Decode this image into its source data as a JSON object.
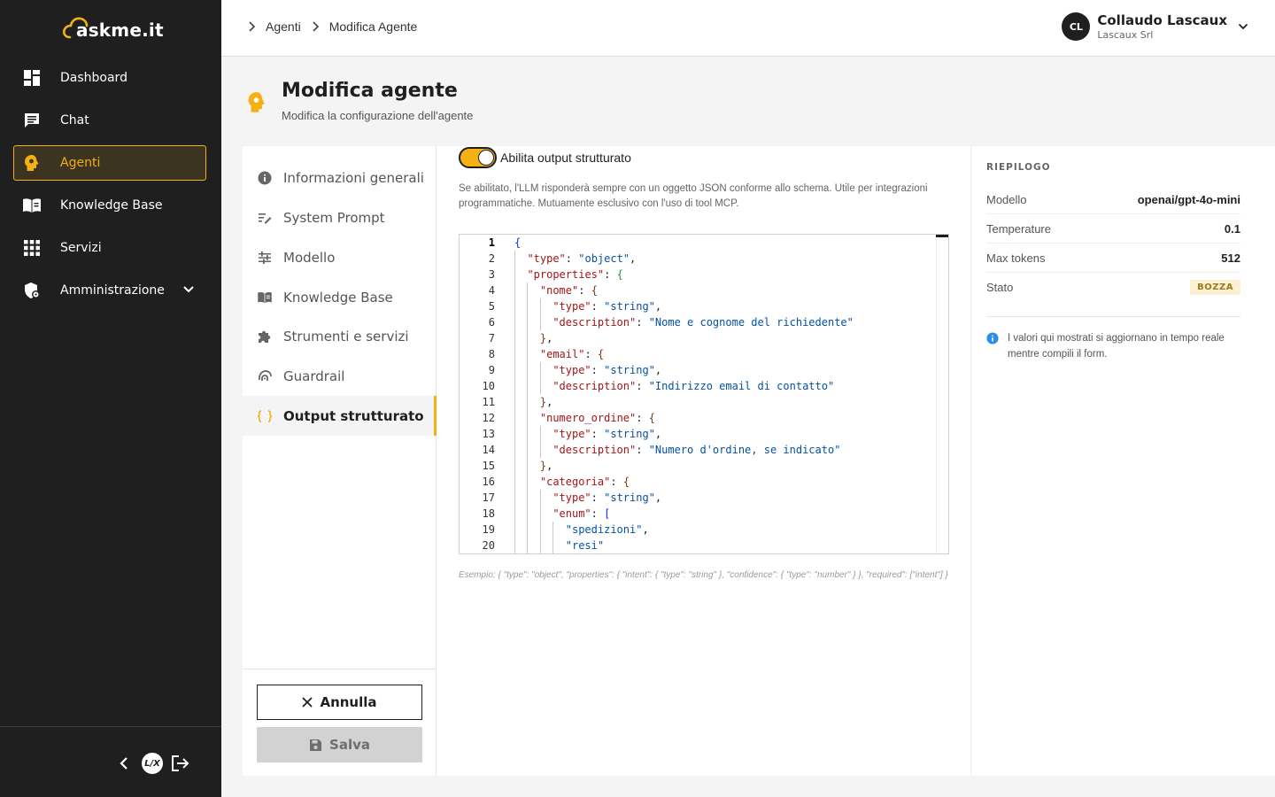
{
  "app": {
    "logo_text": "askme.it"
  },
  "sidebar": {
    "items": [
      {
        "label": "Dashboard",
        "icon": "dashboard-icon"
      },
      {
        "label": "Chat",
        "icon": "chat-icon"
      },
      {
        "label": "Agenti",
        "icon": "agent-icon"
      },
      {
        "label": "Knowledge Base",
        "icon": "book-icon"
      },
      {
        "label": "Servizi",
        "icon": "grid-icon"
      },
      {
        "label": "Amministrazione",
        "icon": "admin-shield-icon"
      }
    ],
    "footer_badge": "L/X"
  },
  "header": {
    "breadcrumb": [
      "Agenti",
      "Modifica Agente"
    ],
    "user": {
      "initials": "CL",
      "name": "Collaudo Lascaux",
      "org": "Lascaux Srl"
    }
  },
  "page": {
    "title": "Modifica agente",
    "subtitle": "Modifica la configurazione dell'agente"
  },
  "tabs": [
    {
      "label": "Informazioni generali",
      "icon": "info-icon"
    },
    {
      "label": "System Prompt",
      "icon": "prompt-edit-icon"
    },
    {
      "label": "Modello",
      "icon": "tune-icon"
    },
    {
      "label": "Knowledge Base",
      "icon": "book-icon"
    },
    {
      "label": "Strumenti e servizi",
      "icon": "puzzle-icon"
    },
    {
      "label": "Guardrail",
      "icon": "guardrail-icon"
    },
    {
      "label": "Output strutturato",
      "icon": "braces-icon"
    }
  ],
  "actions": {
    "cancel": "Annulla",
    "save": "Salva"
  },
  "structured_output": {
    "toggle_label": "Abilita output strutturato",
    "toggle_on": true,
    "help": "Se abilitato, l'LLM risponderà sempre con un oggetto JSON conforme allo schema. Utile per integrazioni programmatiche. Mutuamente esclusivo con l'uso di tool MCP.",
    "example": "Esempio: { \"type\": \"object\", \"properties\": { \"intent\": { \"type\": \"string\" }, \"confidence\": { \"type\": \"number\" } }, \"required\": [\"intent\"] }",
    "code_lines": [
      {
        "n": "1",
        "depth": 0,
        "parts": [
          [
            "b1",
            "{"
          ]
        ]
      },
      {
        "n": "2",
        "depth": 1,
        "parts": [
          [
            "k",
            "\"type\""
          ],
          [
            "p",
            ": "
          ],
          [
            "s",
            "\"object\""
          ],
          [
            "p",
            ","
          ]
        ]
      },
      {
        "n": "3",
        "depth": 1,
        "parts": [
          [
            "k",
            "\"properties\""
          ],
          [
            "p",
            ": "
          ],
          [
            "b2",
            "{"
          ]
        ]
      },
      {
        "n": "4",
        "depth": 2,
        "parts": [
          [
            "k",
            "\"nome\""
          ],
          [
            "p",
            ": "
          ],
          [
            "b3",
            "{"
          ]
        ]
      },
      {
        "n": "5",
        "depth": 3,
        "parts": [
          [
            "k",
            "\"type\""
          ],
          [
            "p",
            ": "
          ],
          [
            "s",
            "\"string\""
          ],
          [
            "p",
            ","
          ]
        ]
      },
      {
        "n": "6",
        "depth": 3,
        "parts": [
          [
            "k",
            "\"description\""
          ],
          [
            "p",
            ": "
          ],
          [
            "s",
            "\"Nome e cognome del richiedente\""
          ]
        ]
      },
      {
        "n": "7",
        "depth": 2,
        "parts": [
          [
            "b3",
            "}"
          ],
          [
            "p",
            ","
          ]
        ]
      },
      {
        "n": "8",
        "depth": 2,
        "parts": [
          [
            "k",
            "\"email\""
          ],
          [
            "p",
            ": "
          ],
          [
            "b3",
            "{"
          ]
        ]
      },
      {
        "n": "9",
        "depth": 3,
        "parts": [
          [
            "k",
            "\"type\""
          ],
          [
            "p",
            ": "
          ],
          [
            "s",
            "\"string\""
          ],
          [
            "p",
            ","
          ]
        ]
      },
      {
        "n": "10",
        "depth": 3,
        "parts": [
          [
            "k",
            "\"description\""
          ],
          [
            "p",
            ": "
          ],
          [
            "s",
            "\"Indirizzo email di contatto\""
          ]
        ]
      },
      {
        "n": "11",
        "depth": 2,
        "parts": [
          [
            "b3",
            "}"
          ],
          [
            "p",
            ","
          ]
        ]
      },
      {
        "n": "12",
        "depth": 2,
        "parts": [
          [
            "k",
            "\"numero_ordine\""
          ],
          [
            "p",
            ": "
          ],
          [
            "b3",
            "{"
          ]
        ]
      },
      {
        "n": "13",
        "depth": 3,
        "parts": [
          [
            "k",
            "\"type\""
          ],
          [
            "p",
            ": "
          ],
          [
            "s",
            "\"string\""
          ],
          [
            "p",
            ","
          ]
        ]
      },
      {
        "n": "14",
        "depth": 3,
        "parts": [
          [
            "k",
            "\"description\""
          ],
          [
            "p",
            ": "
          ],
          [
            "s",
            "\"Numero d'ordine, se indicato\""
          ]
        ]
      },
      {
        "n": "15",
        "depth": 2,
        "parts": [
          [
            "b3",
            "}"
          ],
          [
            "p",
            ","
          ]
        ]
      },
      {
        "n": "16",
        "depth": 2,
        "parts": [
          [
            "k",
            "\"categoria\""
          ],
          [
            "p",
            ": "
          ],
          [
            "b3",
            "{"
          ]
        ]
      },
      {
        "n": "17",
        "depth": 3,
        "parts": [
          [
            "k",
            "\"type\""
          ],
          [
            "p",
            ": "
          ],
          [
            "s",
            "\"string\""
          ],
          [
            "p",
            ","
          ]
        ]
      },
      {
        "n": "18",
        "depth": 3,
        "parts": [
          [
            "k",
            "\"enum\""
          ],
          [
            "p",
            ": "
          ],
          [
            "b1",
            "["
          ]
        ]
      },
      {
        "n": "19",
        "depth": 4,
        "parts": [
          [
            "s",
            "\"spedizioni\""
          ],
          [
            "p",
            ","
          ]
        ]
      },
      {
        "n": "20",
        "depth": 4,
        "parts": [
          [
            "s",
            "\"resi\""
          ]
        ]
      }
    ]
  },
  "summary": {
    "title": "RIEPILOGO",
    "rows": [
      {
        "key": "Modello",
        "value": "openai/gpt-4o-mini"
      },
      {
        "key": "Temperature",
        "value": "0.1"
      },
      {
        "key": "Max tokens",
        "value": "512"
      }
    ],
    "status_key": "Stato",
    "status_value": "BOZZA",
    "info": "I valori qui mostrati si aggiornano in tempo reale mentre compili il form."
  },
  "colors": {
    "accent": "#f5b014",
    "sidebar_bg": "#1f1f1f",
    "badge_bg": "#fbf0d2"
  }
}
